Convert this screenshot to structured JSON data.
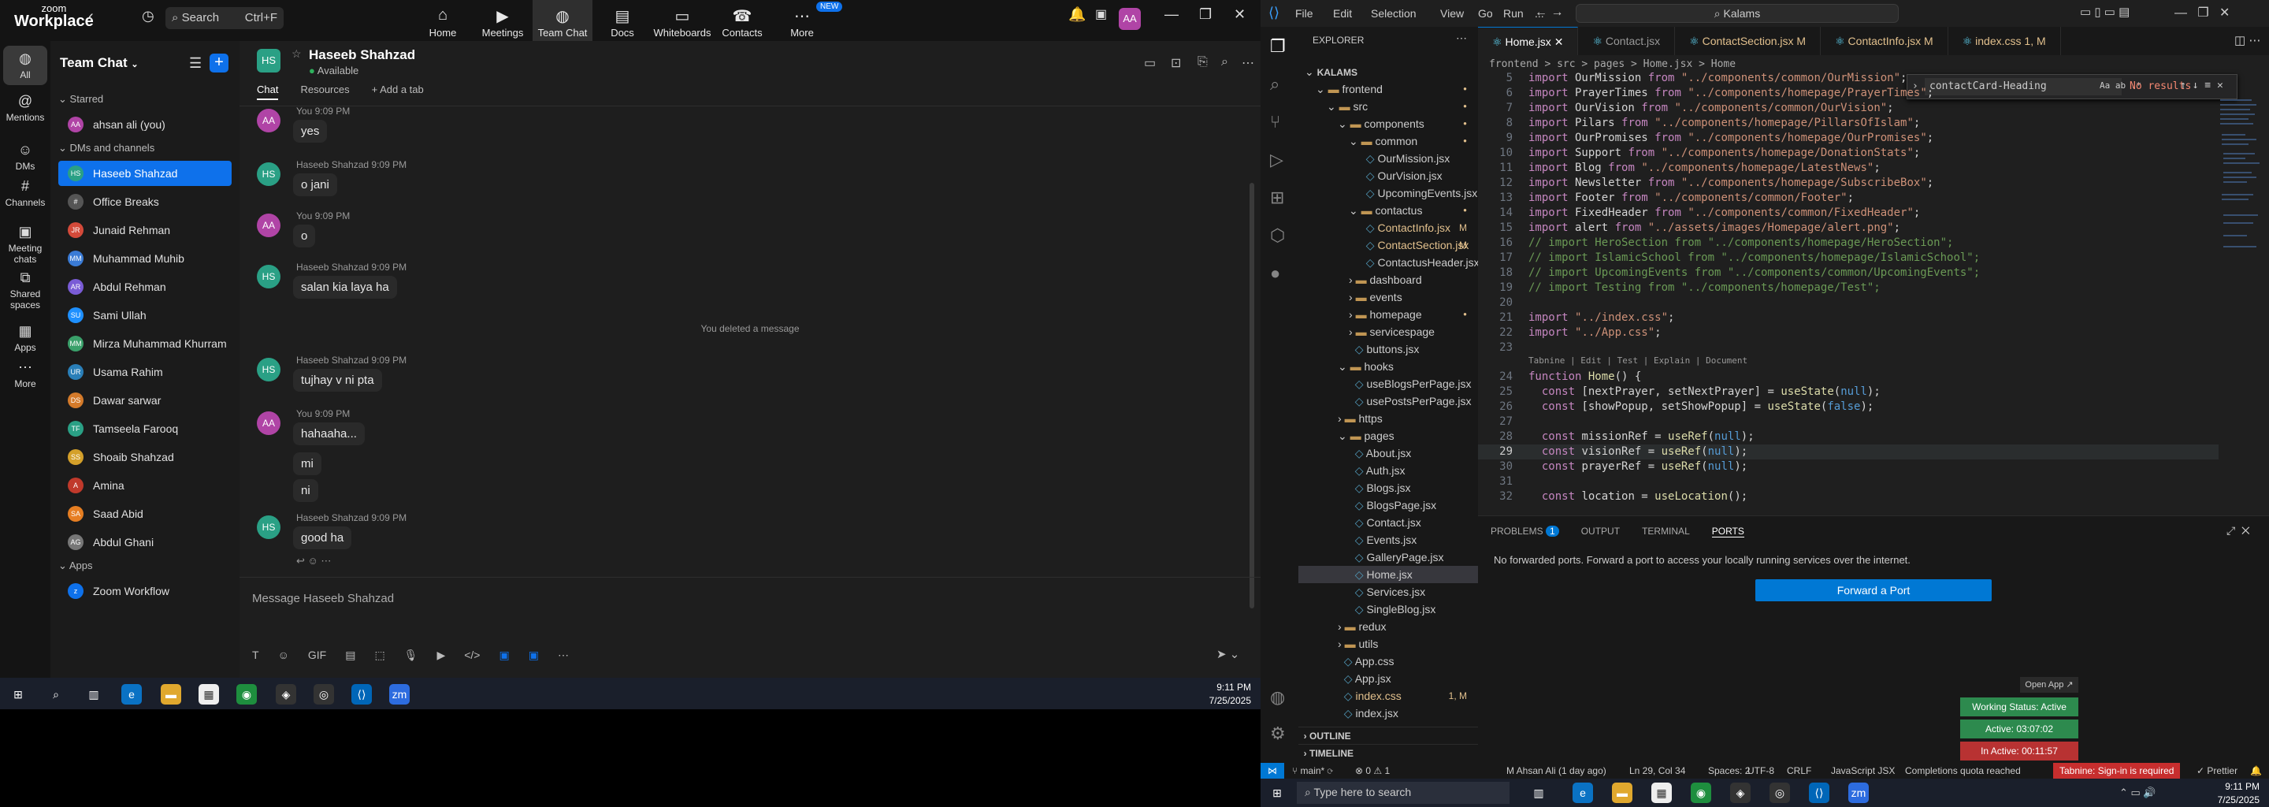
{
  "zoom": {
    "logo_line1": "zoom",
    "logo_line2": "Workplace",
    "search_placeholder": "Search",
    "search_shortcut": "Ctrl+F",
    "nav": [
      {
        "label": "Home",
        "icon": "home-icon"
      },
      {
        "label": "Meetings",
        "icon": "video-icon"
      },
      {
        "label": "Team Chat",
        "icon": "chat-icon"
      },
      {
        "label": "Docs",
        "icon": "docs-icon"
      },
      {
        "label": "Whiteboards",
        "icon": "whiteboard-icon"
      },
      {
        "label": "Contacts",
        "icon": "contacts-icon"
      },
      {
        "label": "More",
        "icon": "more-icon"
      }
    ],
    "new_badge": "NEW",
    "avatar_initials": "AA",
    "rail": [
      {
        "label": "All"
      },
      {
        "label": "Mentions"
      },
      {
        "label": "DMs"
      },
      {
        "label": "Channels"
      },
      {
        "label": "Meeting chats"
      },
      {
        "label": "Shared spaces"
      },
      {
        "label": "Apps"
      },
      {
        "label": "More"
      }
    ],
    "sidebar": {
      "title": "Team Chat",
      "starred_label": "Starred",
      "starred": [
        {
          "name": "ahsan ali (you)",
          "initials": "AA",
          "color": "#b044a6"
        }
      ],
      "dms_label": "DMs and channels",
      "dms": [
        {
          "name": "Haseeb Shahzad",
          "initials": "HS",
          "color": "#2aa085"
        },
        {
          "name": "Office Breaks",
          "initials": "#",
          "color": "#555"
        },
        {
          "name": "Junaid Rehman",
          "initials": "JR",
          "color": "#d44a3a"
        },
        {
          "name": "Muhammad Muhib",
          "initials": "MM",
          "color": "#3a7bd5"
        },
        {
          "name": "Abdul Rehman",
          "initials": "AR",
          "color": "#7a5cd6"
        },
        {
          "name": "Sami Ullah",
          "initials": "SU",
          "color": "#1e90ff"
        },
        {
          "name": "Mirza Muhammad Khurram",
          "initials": "MM",
          "color": "#3aa06a"
        },
        {
          "name": "Usama Rahim",
          "initials": "UR",
          "color": "#2a7fb8"
        },
        {
          "name": "Dawar sarwar",
          "initials": "DS",
          "color": "#d47a2a"
        },
        {
          "name": "Tamseela Farooq",
          "initials": "TF",
          "color": "#2aa085"
        },
        {
          "name": "Shoaib Shahzad",
          "initials": "SS",
          "color": "#d4a02a"
        },
        {
          "name": "Amina",
          "initials": "A",
          "color": "#c0392b"
        },
        {
          "name": "Saad Abid",
          "initials": "SA",
          "color": "#e67e22"
        },
        {
          "name": "Abdul Ghani",
          "initials": "AG",
          "color": "#777"
        }
      ],
      "apps_label": "Apps",
      "apps": [
        {
          "name": "Zoom Workflow",
          "initials": "z",
          "color": "#0e71eb"
        }
      ]
    },
    "chat": {
      "name": "Haseeb Shahzad",
      "initials": "HS",
      "status": "Available",
      "tabs": [
        "Chat",
        "Resources",
        "+ Add a tab"
      ],
      "messages": [
        {
          "author": "You",
          "time": "9:09 PM",
          "text": "yes",
          "initials": "AA",
          "color": "#b044a6"
        },
        {
          "author": "Haseeb Shahzad",
          "time": "9:09 PM",
          "text": "o jani",
          "initials": "HS",
          "color": "#2aa085"
        },
        {
          "author": "You",
          "time": "9:09 PM",
          "text": "o",
          "initials": "AA",
          "color": "#b044a6"
        },
        {
          "author": "Haseeb Shahzad",
          "time": "9:09 PM",
          "text": "salan kia laya ha",
          "initials": "HS",
          "color": "#2aa085"
        },
        {
          "system": "You deleted a message"
        },
        {
          "author": "Haseeb Shahzad",
          "time": "9:09 PM",
          "text": "tujhay v ni pta",
          "initials": "HS",
          "color": "#2aa085"
        },
        {
          "author": "You",
          "time": "9:09 PM",
          "text": "hahaaha...",
          "initials": "AA",
          "color": "#b044a6"
        },
        {
          "text": "mi"
        },
        {
          "text": "ni"
        },
        {
          "author": "Haseeb Shahzad",
          "time": "9:09 PM",
          "text": "good ha",
          "initials": "HS",
          "color": "#2aa085"
        }
      ],
      "compose_placeholder": "Message Haseeb Shahzad"
    }
  },
  "taskbar1": {
    "time": "9:11 PM",
    "date": "7/25/2025"
  },
  "vscode": {
    "menu": [
      "File",
      "Edit",
      "Selection",
      "View",
      "Go",
      "Run",
      "..."
    ],
    "command_center": "Kalams",
    "explorer_title": "EXPLORER",
    "tree": [
      {
        "label": "KALAMS",
        "depth": 0,
        "kind": "root"
      },
      {
        "label": "frontend",
        "depth": 1,
        "kind": "folder-open",
        "mod": "dot"
      },
      {
        "label": "src",
        "depth": 2,
        "kind": "folder-open",
        "mod": "dot"
      },
      {
        "label": "components",
        "depth": 3,
        "kind": "folder-open",
        "mod": "dot"
      },
      {
        "label": "common",
        "depth": 4,
        "kind": "folder-open",
        "mod": "dot"
      },
      {
        "label": "OurMission.jsx",
        "depth": 5,
        "kind": "file"
      },
      {
        "label": "OurVision.jsx",
        "depth": 5,
        "kind": "file"
      },
      {
        "label": "UpcomingEvents.jsx",
        "depth": 5,
        "kind": "file"
      },
      {
        "label": "contactus",
        "depth": 4,
        "kind": "folder-open",
        "mod": "dot"
      },
      {
        "label": "ContactInfo.jsx",
        "depth": 5,
        "kind": "file",
        "mod": "M"
      },
      {
        "label": "ContactSection.jsx",
        "depth": 5,
        "kind": "file",
        "mod": "M"
      },
      {
        "label": "ContactusHeader.jsx",
        "depth": 5,
        "kind": "file"
      },
      {
        "label": "dashboard",
        "depth": 4,
        "kind": "folder"
      },
      {
        "label": "events",
        "depth": 4,
        "kind": "folder"
      },
      {
        "label": "homepage",
        "depth": 4,
        "kind": "folder",
        "mod": "dot"
      },
      {
        "label": "servicespage",
        "depth": 4,
        "kind": "folder"
      },
      {
        "label": "buttons.jsx",
        "depth": 4,
        "kind": "file"
      },
      {
        "label": "hooks",
        "depth": 3,
        "kind": "folder-open"
      },
      {
        "label": "useBlogsPerPage.jsx",
        "depth": 4,
        "kind": "file"
      },
      {
        "label": "usePostsPerPage.jsx",
        "depth": 4,
        "kind": "file"
      },
      {
        "label": "https",
        "depth": 3,
        "kind": "folder"
      },
      {
        "label": "pages",
        "depth": 3,
        "kind": "folder-open"
      },
      {
        "label": "About.jsx",
        "depth": 4,
        "kind": "file"
      },
      {
        "label": "Auth.jsx",
        "depth": 4,
        "kind": "file"
      },
      {
        "label": "Blogs.jsx",
        "depth": 4,
        "kind": "file"
      },
      {
        "label": "BlogsPage.jsx",
        "depth": 4,
        "kind": "file"
      },
      {
        "label": "Contact.jsx",
        "depth": 4,
        "kind": "file"
      },
      {
        "label": "Events.jsx",
        "depth": 4,
        "kind": "file"
      },
      {
        "label": "GalleryPage.jsx",
        "depth": 4,
        "kind": "file"
      },
      {
        "label": "Home.jsx",
        "depth": 4,
        "kind": "file",
        "selected": true
      },
      {
        "label": "Services.jsx",
        "depth": 4,
        "kind": "file"
      },
      {
        "label": "SingleBlog.jsx",
        "depth": 4,
        "kind": "file"
      },
      {
        "label": "redux",
        "depth": 3,
        "kind": "folder"
      },
      {
        "label": "utils",
        "depth": 3,
        "kind": "folder"
      },
      {
        "label": "App.css",
        "depth": 3,
        "kind": "file"
      },
      {
        "label": "App.jsx",
        "depth": 3,
        "kind": "file"
      },
      {
        "label": "index.css",
        "depth": 3,
        "kind": "file",
        "mod": "1, M"
      },
      {
        "label": "index.jsx",
        "depth": 3,
        "kind": "file"
      }
    ],
    "outline_label": "OUTLINE",
    "timeline_label": "TIMELINE",
    "tabs": [
      {
        "label": "Home.jsx",
        "active": true
      },
      {
        "label": "Contact.jsx"
      },
      {
        "label": "ContactSection.jsx M"
      },
      {
        "label": "ContactInfo.jsx M"
      },
      {
        "label": "index.css 1, M"
      }
    ],
    "breadcrumb": "frontend > src > pages > Home.jsx > Home",
    "find_value": "contactCard-Heading",
    "find_result": "No results",
    "codelens": "Tabnine | Edit | Test | Explain | Document",
    "code": [
      {
        "n": "5",
        "t": "import OurMission from \"../components/common/OurMission\";"
      },
      {
        "n": "6",
        "t": "import PrayerTimes from \"../components/homepage/PrayerTimes\";"
      },
      {
        "n": "7",
        "t": "import OurVision from \"../components/common/OurVision\";"
      },
      {
        "n": "8",
        "t": "import Pilars from \"../components/homepage/PillarsOfIslam\";"
      },
      {
        "n": "9",
        "t": "import OurPromises from \"../components/homepage/OurPromises\";"
      },
      {
        "n": "10",
        "t": "import Support from \"../components/homepage/DonationStats\";"
      },
      {
        "n": "11",
        "t": "import Blog from \"../components/homepage/LatestNews\";"
      },
      {
        "n": "12",
        "t": "import Newsletter from \"../components/homepage/SubscribeBox\";"
      },
      {
        "n": "13",
        "t": "import Footer from \"../components/common/Footer\";"
      },
      {
        "n": "14",
        "t": "import FixedHeader from \"../components/common/FixedHeader\";"
      },
      {
        "n": "15",
        "t": "import alert from \"../assets/images/Homepage/alert.png\";"
      },
      {
        "n": "16",
        "t": "// import HeroSection from \"../components/homepage/HeroSection\";"
      },
      {
        "n": "17",
        "t": "// import IslamicSchool from \"../components/homepage/IslamicSchool\";"
      },
      {
        "n": "18",
        "t": "// import UpcomingEvents from \"../components/common/UpcomingEvents\";"
      },
      {
        "n": "19",
        "t": "// import Testing from \"../components/homepage/Test\";"
      },
      {
        "n": "20",
        "t": ""
      },
      {
        "n": "21",
        "t": "import \"../index.css\";"
      },
      {
        "n": "22",
        "t": "import \"../App.css\";"
      },
      {
        "n": "23",
        "t": ""
      },
      {
        "n": "24",
        "t": "function Home() {"
      },
      {
        "n": "25",
        "t": "  const [nextPrayer, setNextPrayer] = useState(null);"
      },
      {
        "n": "26",
        "t": "  const [showPopup, setShowPopup] = useState(false);"
      },
      {
        "n": "27",
        "t": ""
      },
      {
        "n": "28",
        "t": "  const missionRef = useRef(null);"
      },
      {
        "n": "29",
        "t": "  const visionRef = useRef(null);"
      },
      {
        "n": "30",
        "t": "  const prayerRef = useRef(null);"
      },
      {
        "n": "31",
        "t": ""
      },
      {
        "n": "32",
        "t": "  const location = useLocation();"
      }
    ],
    "panel_tabs": [
      "PROBLEMS",
      "OUTPUT",
      "TERMINAL",
      "PORTS"
    ],
    "problems_count": "1",
    "ports_message": "No forwarded ports. Forward a port to access your locally running services over the internet.",
    "forward_button": "Forward a Port",
    "open_app": "Open App ↗",
    "working_status": "Working Status: Active",
    "active_time": "Active: 03:07:02",
    "inactive_time": "In Active: 00:11:57",
    "status": {
      "branch": "main*",
      "errors": "0",
      "warnings": "1",
      "blame": "M Ahsan Ali (1 day ago)",
      "position": "Ln 29, Col 34",
      "spaces": "Spaces: 2",
      "encoding": "UTF-8",
      "eol": "CRLF",
      "language": "JavaScript JSX",
      "quota": "Completions quota reached",
      "tabnine": "Tabnine: Sign-in is required",
      "prettier": "Prettier"
    }
  },
  "taskbar2": {
    "search_placeholder": "Type here to search",
    "time": "9:11 PM",
    "date": "7/25/2025"
  }
}
